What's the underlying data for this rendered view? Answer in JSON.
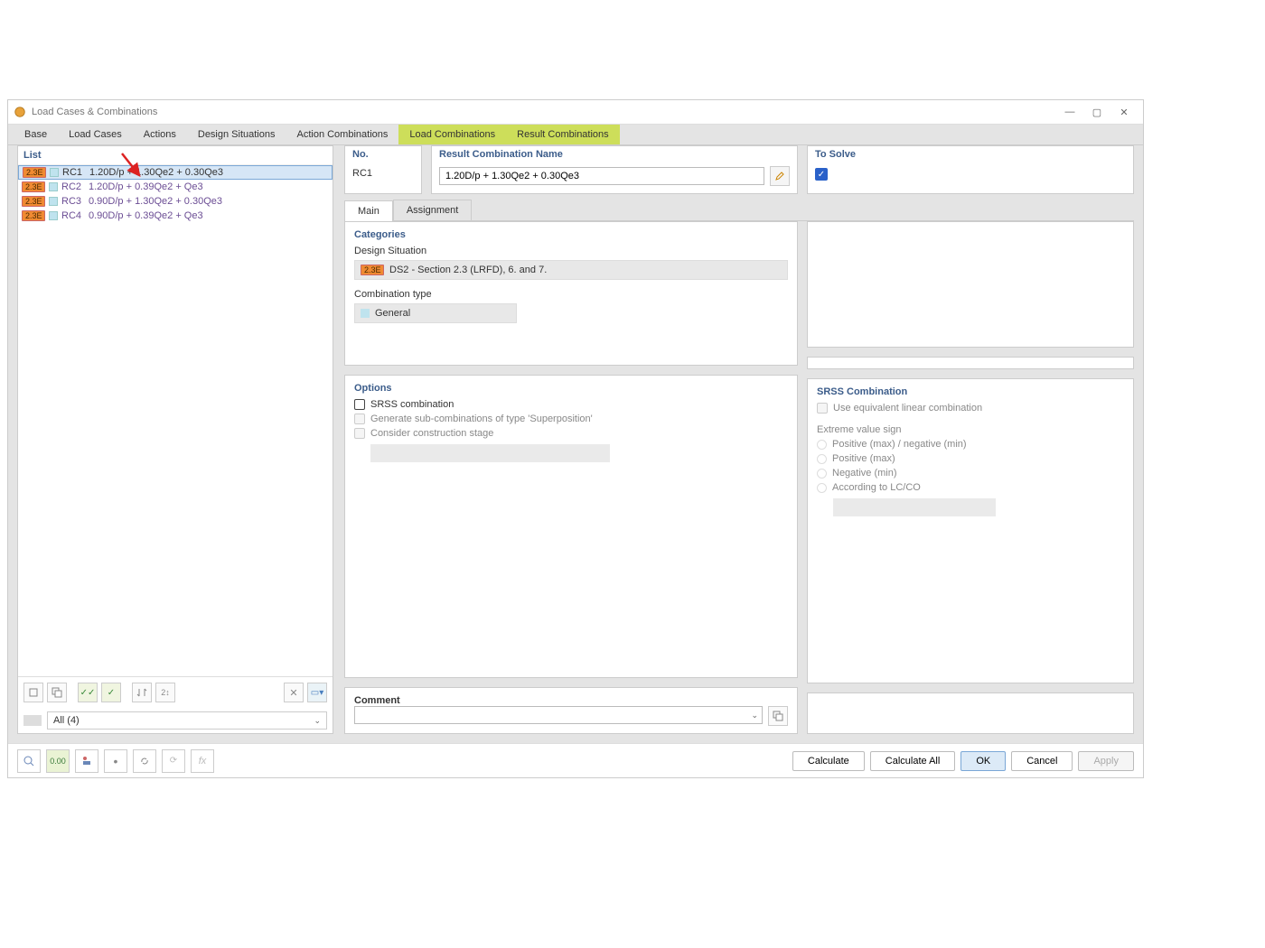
{
  "window": {
    "title": "Load Cases & Combinations"
  },
  "tabs": [
    "Base",
    "Load Cases",
    "Actions",
    "Design Situations",
    "Action Combinations",
    "Load Combinations",
    "Result Combinations"
  ],
  "list": {
    "header": "List",
    "items": [
      {
        "pill": "2.3E",
        "id": "RC1",
        "desc": "1.20D/p + 1.30Qe2 + 0.30Qe3",
        "selected": true
      },
      {
        "pill": "2.3E",
        "id": "RC2",
        "desc": "1.20D/p + 0.39Qe2 + Qe3",
        "selected": false
      },
      {
        "pill": "2.3E",
        "id": "RC3",
        "desc": "0.90D/p + 1.30Qe2 + 0.30Qe3",
        "selected": false
      },
      {
        "pill": "2.3E",
        "id": "RC4",
        "desc": "0.90D/p + 0.39Qe2 + Qe3",
        "selected": false
      }
    ],
    "filter": "All (4)"
  },
  "detail": {
    "no_label": "No.",
    "no_value": "RC1",
    "name_label": "Result Combination Name",
    "name_value": "1.20D/p + 1.30Qe2 + 0.30Qe3",
    "solve_label": "To Solve",
    "subtabs": {
      "main": "Main",
      "assignment": "Assignment"
    },
    "categories": {
      "title": "Categories",
      "ds_label": "Design Situation",
      "ds_pill": "2.3E",
      "ds_value": "DS2 - Section 2.3 (LRFD), 6. and 7.",
      "ct_label": "Combination type",
      "ct_value": "General"
    },
    "options": {
      "title": "Options",
      "srss": "SRSS combination",
      "gensub": "Generate sub-combinations of type 'Superposition'",
      "stage": "Consider construction stage"
    },
    "srssc": {
      "title": "SRSS Combination",
      "ulc": "Use equivalent linear combination",
      "evs": "Extreme value sign",
      "r1": "Positive (max) / negative (min)",
      "r2": "Positive (max)",
      "r3": "Negative (min)",
      "r4": "According to LC/CO"
    },
    "comment": {
      "title": "Comment"
    }
  },
  "buttons": {
    "calculate": "Calculate",
    "calculate_all": "Calculate All",
    "ok": "OK",
    "cancel": "Cancel",
    "apply": "Apply"
  }
}
